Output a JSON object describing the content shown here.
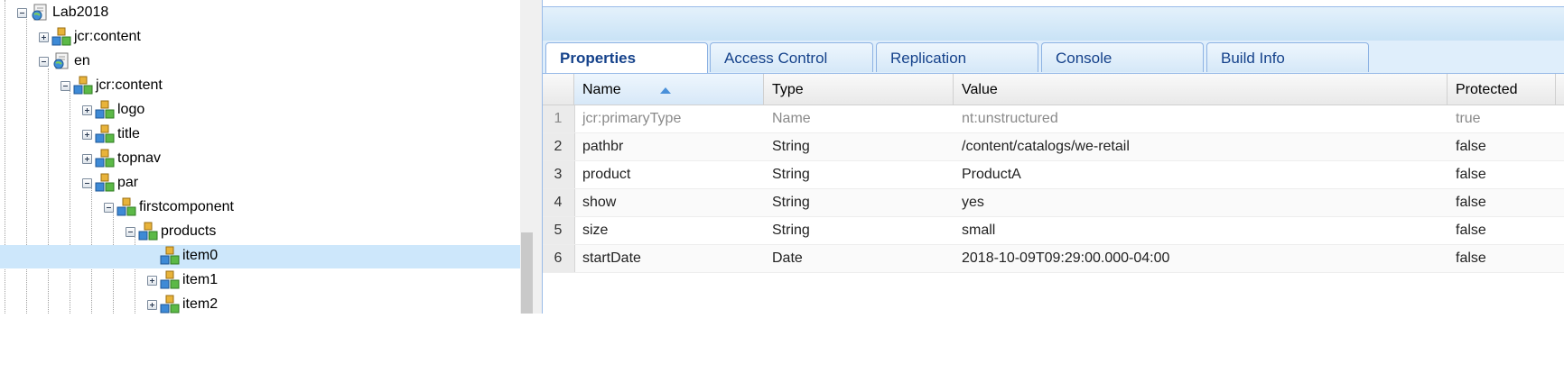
{
  "tree": {
    "nodes": [
      {
        "label": "Lab2018",
        "expander": "minus",
        "icon": "page-icon",
        "selected": false
      },
      {
        "label": "jcr:content",
        "expander": "plus",
        "icon": "node-icon",
        "selected": false
      },
      {
        "label": "en",
        "expander": "minus",
        "icon": "page-icon",
        "selected": false
      },
      {
        "label": "jcr:content",
        "expander": "minus",
        "icon": "node-icon",
        "selected": false
      },
      {
        "label": "logo",
        "expander": "plus",
        "icon": "node-icon",
        "selected": false
      },
      {
        "label": "title",
        "expander": "plus",
        "icon": "node-icon",
        "selected": false
      },
      {
        "label": "topnav",
        "expander": "plus",
        "icon": "node-icon",
        "selected": false
      },
      {
        "label": "par",
        "expander": "minus",
        "icon": "node-icon",
        "selected": false
      },
      {
        "label": "firstcomponent",
        "expander": "minus",
        "icon": "node-icon",
        "selected": false
      },
      {
        "label": "products",
        "expander": "minus",
        "icon": "node-icon",
        "selected": false
      },
      {
        "label": "item0",
        "expander": "none",
        "icon": "node-icon",
        "selected": true
      },
      {
        "label": "item1",
        "expander": "plus",
        "icon": "node-icon",
        "selected": false
      },
      {
        "label": "item2",
        "expander": "plus",
        "icon": "node-icon",
        "selected": false
      }
    ]
  },
  "tabs": [
    {
      "label": "Properties",
      "active": true
    },
    {
      "label": "Access Control",
      "active": false
    },
    {
      "label": "Replication",
      "active": false
    },
    {
      "label": "Console",
      "active": false
    },
    {
      "label": "Build Info",
      "active": false
    }
  ],
  "grid": {
    "columns": [
      "Name",
      "Type",
      "Value",
      "Protected"
    ],
    "sorted_column": "Name",
    "sort_direction": "ascending",
    "rows": [
      {
        "num": "1",
        "name": "jcr:primaryType",
        "type": "Name",
        "value": "nt:unstructured",
        "protected": "true"
      },
      {
        "num": "2",
        "name": "pathbr",
        "type": "String",
        "value": "/content/catalogs/we-retail",
        "protected": "false"
      },
      {
        "num": "3",
        "name": "product",
        "type": "String",
        "value": "ProductA",
        "protected": "false"
      },
      {
        "num": "4",
        "name": "show",
        "type": "String",
        "value": "yes",
        "protected": "false"
      },
      {
        "num": "5",
        "name": "size",
        "type": "String",
        "value": "small",
        "protected": "false"
      },
      {
        "num": "6",
        "name": "startDate",
        "type": "Date",
        "value": "2018-10-09T09:29:00.000-04:00",
        "protected": "false"
      }
    ]
  },
  "colors": {
    "selection": "#cde7fb",
    "tab_text": "#15428b",
    "panel_border": "#99bbe8"
  }
}
